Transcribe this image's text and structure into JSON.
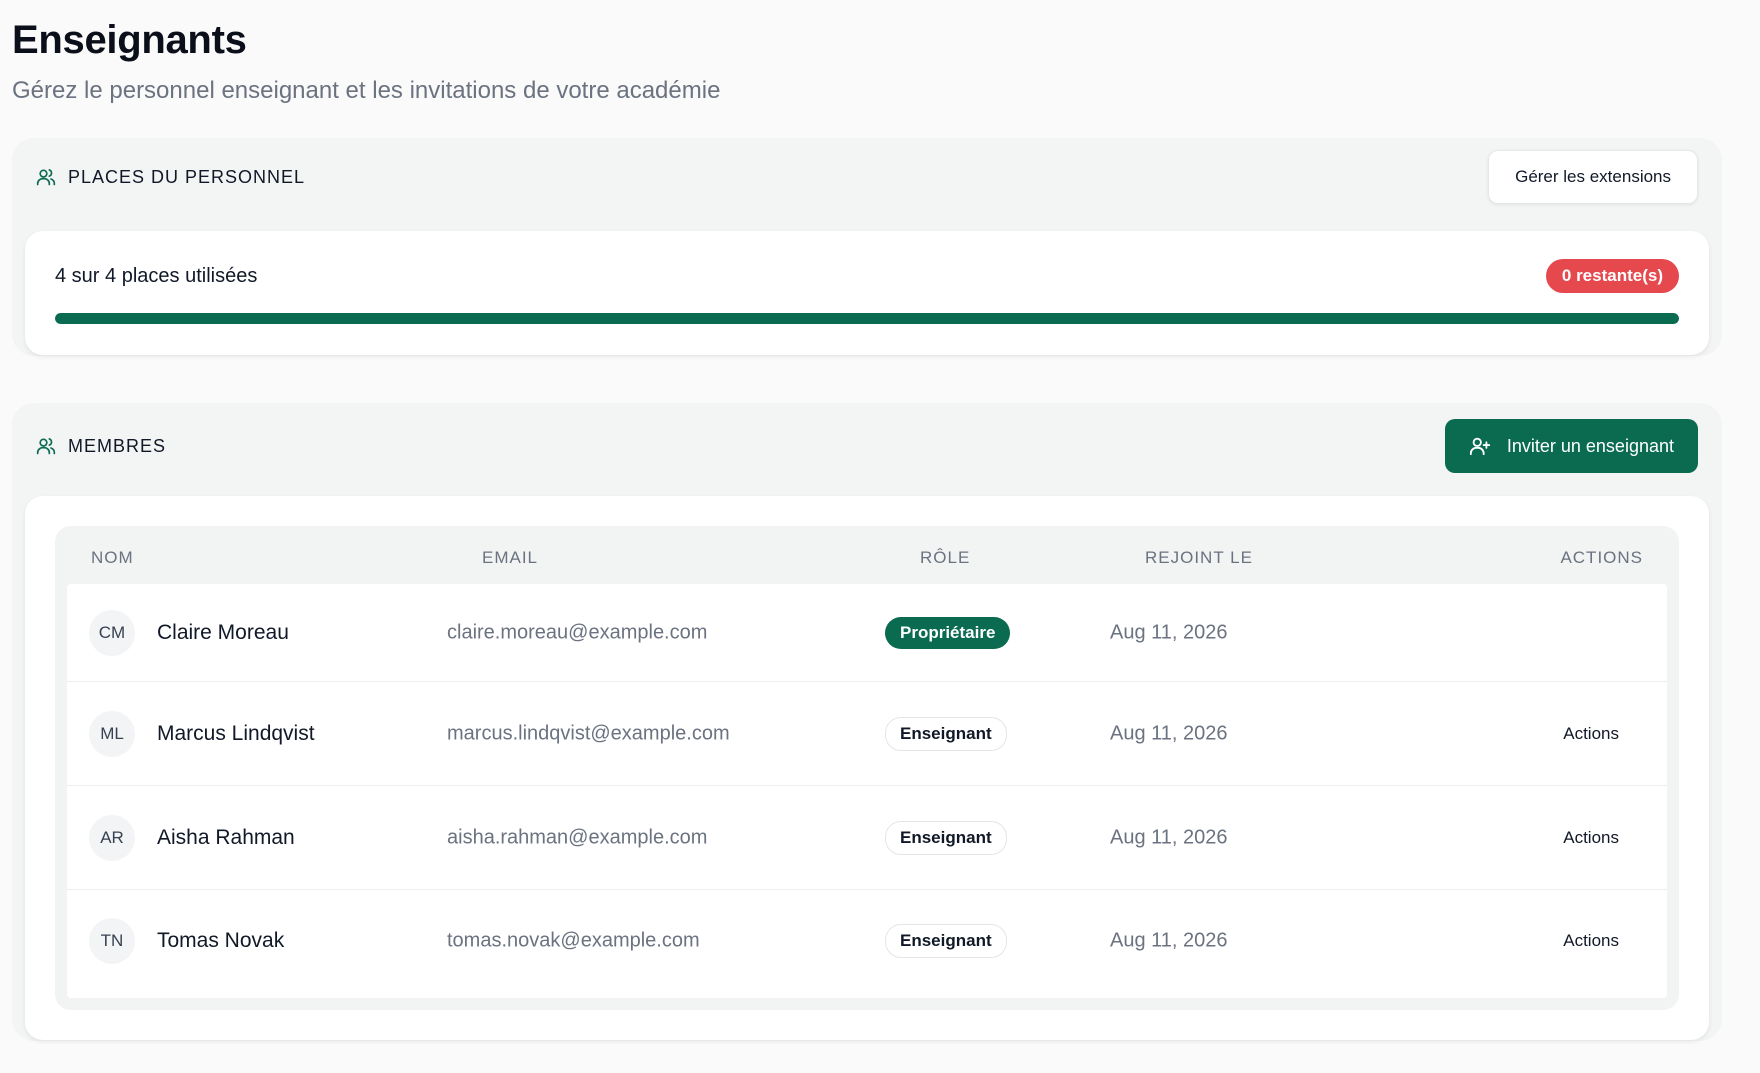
{
  "page": {
    "title": "Enseignants",
    "subtitle": "Gérez le personnel enseignant et les invitations de votre académie"
  },
  "seats": {
    "label": "PLACES DU PERSONNEL",
    "icon": "users-icon",
    "manage_button": "Gérer les extensions",
    "usage_text": "4 sur 4 places utilisées",
    "remaining_badge": "0 restante(s)",
    "used": 4,
    "total": 4,
    "progress_fraction": 1.0
  },
  "members": {
    "label": "MEMBRES",
    "icon": "users-icon",
    "invite_button": "Inviter un enseignant",
    "invite_icon": "user-plus-icon",
    "columns": [
      "NOM",
      "EMAIL",
      "RÔLE",
      "REJOINT LE",
      "ACTIONS"
    ],
    "rows": [
      {
        "initials": "CM",
        "name": "Claire Moreau",
        "email": "claire.moreau@example.com",
        "role": "Propriétaire",
        "joined": "Aug 11, 2026",
        "action": ""
      },
      {
        "initials": "ML",
        "name": "Marcus Lindqvist",
        "email": "marcus.lindqvist@example.com",
        "role": "Enseignant",
        "joined": "Aug 11, 2026",
        "action": "Actions"
      },
      {
        "initials": "AR",
        "name": "Aisha Rahman",
        "email": "aisha.rahman@example.com",
        "role": "Enseignant",
        "joined": "Aug 11, 2026",
        "action": "Actions"
      },
      {
        "initials": "TN",
        "name": "Tomas Novak",
        "email": "tomas.novak@example.com",
        "role": "Enseignant",
        "joined": "Aug 11, 2026",
        "action": "Actions"
      }
    ]
  },
  "colors": {
    "accent": "#0b6b50",
    "danger": "#e5484d",
    "muted_text": "#6b7280",
    "background": "#fafafa"
  }
}
